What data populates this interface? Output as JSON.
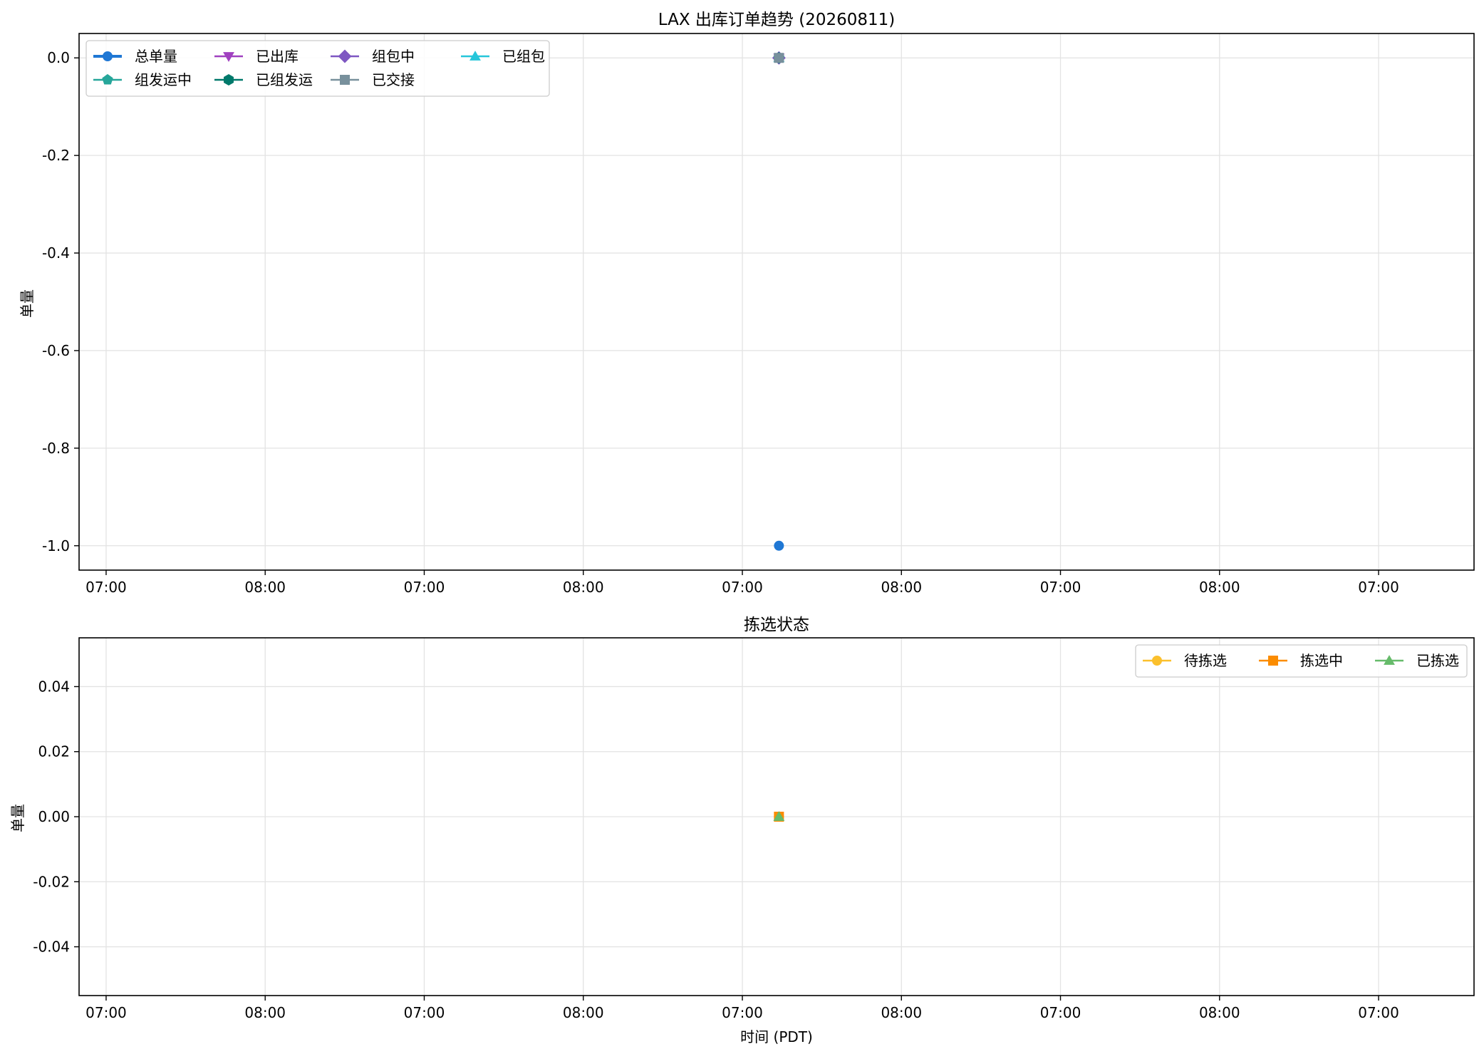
{
  "chart_data": [
    {
      "type": "line",
      "title": "LAX 出库订单趋势 (20260811)",
      "xlabel": "",
      "ylabel": "单量",
      "xlim": [
        -0.17,
        8.6
      ],
      "ylim": [
        -1.05,
        0.05
      ],
      "yticks": [
        0.0,
        -0.2,
        -0.4,
        -0.6,
        -0.8,
        -1.0
      ],
      "ytick_labels": [
        "0.0",
        "-0.2",
        "-0.4",
        "-0.6",
        "-0.8",
        "-1.0"
      ],
      "xticks": [
        0,
        1,
        2,
        3,
        4,
        5,
        6,
        7,
        8
      ],
      "xtick_labels": [
        "07:00",
        "08:00",
        "07:00",
        "08:00",
        "07:00",
        "08:00",
        "07:00",
        "08:00",
        "07:00"
      ],
      "grid": true,
      "legend": "top-left",
      "legend_ncol": 4,
      "series": [
        {
          "name": "总单量",
          "color": "#1f77d4",
          "marker": "circle",
          "points": [
            {
              "x": 4.23,
              "y": -1.0
            }
          ]
        },
        {
          "name": "已出库",
          "color": "#a040c0",
          "marker": "triangle-down",
          "points": [
            {
              "x": 4.23,
              "y": 0.0
            }
          ]
        },
        {
          "name": "组包中",
          "color": "#7e57c2",
          "marker": "diamond",
          "points": [
            {
              "x": 4.23,
              "y": 0.0
            }
          ]
        },
        {
          "name": "已组包",
          "color": "#26c6da",
          "marker": "triangle-up",
          "points": [
            {
              "x": 4.23,
              "y": 0.0
            }
          ]
        },
        {
          "name": "组发运中",
          "color": "#26a69a",
          "marker": "pentagon",
          "points": [
            {
              "x": 4.23,
              "y": 0.0
            }
          ]
        },
        {
          "name": "已组发运",
          "color": "#00796b",
          "marker": "hexagon",
          "points": [
            {
              "x": 4.23,
              "y": 0.0
            }
          ]
        },
        {
          "name": "已交接",
          "color": "#78909c",
          "marker": "square",
          "points": [
            {
              "x": 4.23,
              "y": 0.0
            }
          ]
        }
      ]
    },
    {
      "type": "line",
      "title": "拣选状态",
      "xlabel": "时间 (PDT)",
      "ylabel": "单量",
      "xlim": [
        -0.17,
        8.6
      ],
      "ylim": [
        -0.055,
        0.055
      ],
      "yticks": [
        0.04,
        0.02,
        0.0,
        -0.02,
        -0.04
      ],
      "ytick_labels": [
        "0.04",
        "0.02",
        "0.00",
        "-0.02",
        "-0.04"
      ],
      "xticks": [
        0,
        1,
        2,
        3,
        4,
        5,
        6,
        7,
        8
      ],
      "xtick_labels": [
        "07:00",
        "08:00",
        "07:00",
        "08:00",
        "07:00",
        "08:00",
        "07:00",
        "08:00",
        "07:00"
      ],
      "grid": true,
      "legend": "top-right",
      "legend_ncol": 3,
      "series": [
        {
          "name": "待拣选",
          "color": "#fbc02d",
          "marker": "circle",
          "points": [
            {
              "x": 4.23,
              "y": 0.0
            }
          ]
        },
        {
          "name": "拣选中",
          "color": "#fb8c00",
          "marker": "square",
          "points": [
            {
              "x": 4.23,
              "y": 0.0
            }
          ]
        },
        {
          "name": "已拣选",
          "color": "#66bb6a",
          "marker": "triangle-up",
          "points": [
            {
              "x": 4.23,
              "y": 0.0
            }
          ]
        }
      ]
    }
  ]
}
